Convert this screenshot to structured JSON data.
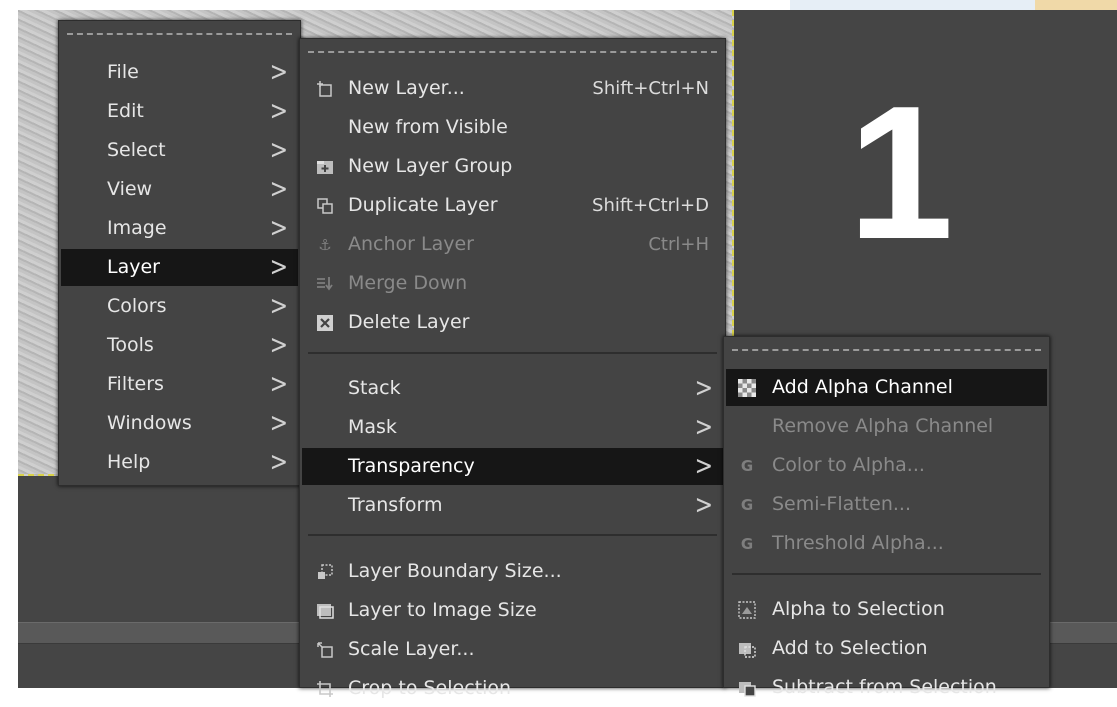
{
  "step_number": "1",
  "main_menu": {
    "items": [
      {
        "label": "File"
      },
      {
        "label": "Edit"
      },
      {
        "label": "Select"
      },
      {
        "label": "View"
      },
      {
        "label": "Image"
      },
      {
        "label": "Layer",
        "highlighted": true
      },
      {
        "label": "Colors"
      },
      {
        "label": "Tools"
      },
      {
        "label": "Filters"
      },
      {
        "label": "Windows"
      },
      {
        "label": "Help"
      }
    ],
    "submenu_arrow": ">"
  },
  "layer_menu": {
    "new_layer": {
      "label": "New Layer...",
      "accel": "Shift+Ctrl+N"
    },
    "new_from_visible": {
      "label": "New from Visible"
    },
    "new_layer_group": {
      "label": "New Layer Group"
    },
    "duplicate_layer": {
      "label": "Duplicate Layer",
      "accel": "Shift+Ctrl+D"
    },
    "anchor_layer": {
      "label": "Anchor Layer",
      "accel": "Ctrl+H",
      "disabled": true
    },
    "merge_down": {
      "label": "Merge Down",
      "disabled": true
    },
    "delete_layer": {
      "label": "Delete Layer"
    },
    "stack": {
      "label": "Stack"
    },
    "mask": {
      "label": "Mask"
    },
    "transparency": {
      "label": "Transparency",
      "highlighted": true
    },
    "transform": {
      "label": "Transform"
    },
    "layer_boundary_size": {
      "label": "Layer Boundary Size..."
    },
    "layer_to_image_size": {
      "label": "Layer to Image Size"
    },
    "scale_layer": {
      "label": "Scale Layer..."
    },
    "crop_to_selection": {
      "label": "Crop to Selection"
    }
  },
  "transparency_menu": {
    "add_alpha_channel": {
      "label": "Add Alpha Channel",
      "highlighted": true
    },
    "remove_alpha_channel": {
      "label": "Remove Alpha Channel",
      "disabled": true
    },
    "color_to_alpha": {
      "label": "Color to Alpha...",
      "disabled": true
    },
    "semi_flatten": {
      "label": "Semi-Flatten...",
      "disabled": true
    },
    "threshold_alpha": {
      "label": "Threshold Alpha...",
      "disabled": true
    },
    "alpha_to_selection": {
      "label": "Alpha to Selection"
    },
    "add_to_selection": {
      "label": "Add to Selection"
    },
    "subtract_from_selection": {
      "label": "Subtract from Selection"
    }
  },
  "icons": {
    "gegl": "G",
    "anchor": "⚓",
    "close": "✕"
  },
  "colors": {
    "menu_bg": "#444444",
    "highlight": "#161616",
    "text": "#e6e6e6",
    "disabled_text": "#8a8a8a",
    "workspace": "#454545"
  }
}
